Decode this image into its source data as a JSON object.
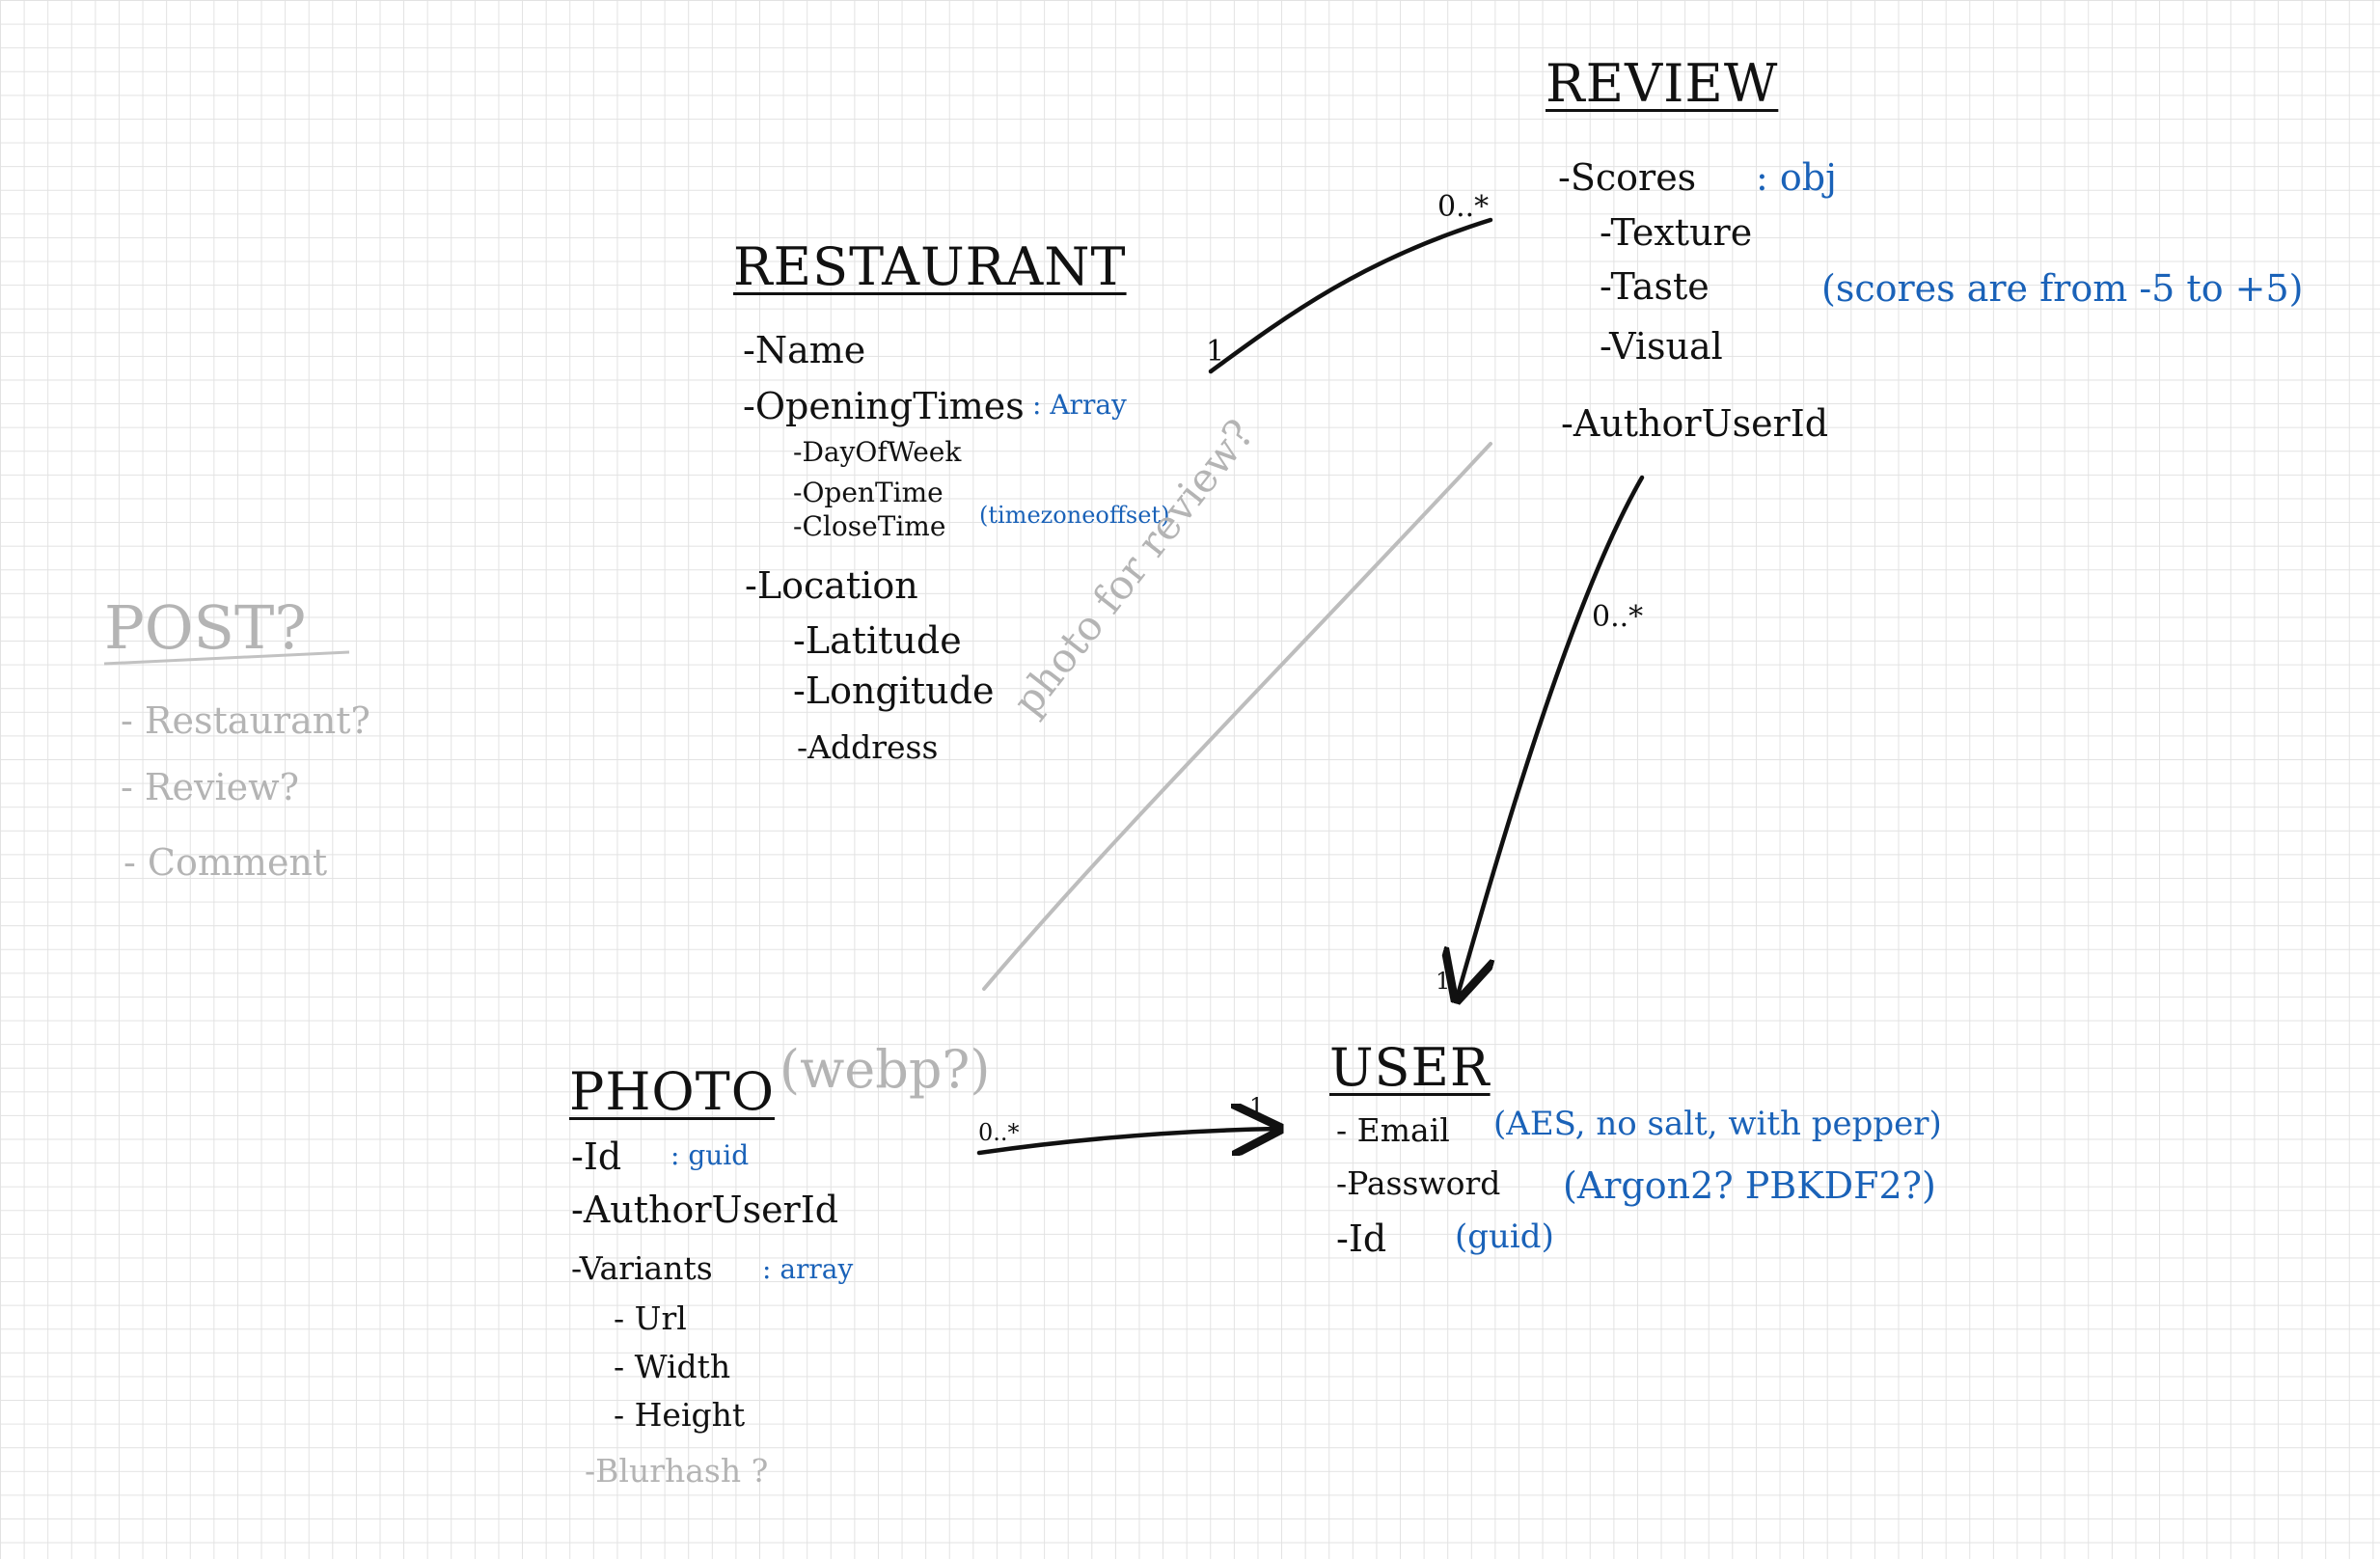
{
  "diagram": {
    "review": {
      "title": "REVIEW",
      "scores": "-Scores",
      "scores_type": ": obj",
      "texture": "-Texture",
      "taste": "-Taste",
      "visual": "-Visual",
      "scores_note": "(scores are from -5 to +5)",
      "author_user_id": "-AuthorUserId"
    },
    "restaurant": {
      "title": "RESTAURANT",
      "name": "-Name",
      "opening_times": "-OpeningTimes",
      "opening_times_type": ": Array",
      "day_of_week": "-DayOfWeek",
      "open_time": "-OpenTime",
      "close_time": "-CloseTime",
      "time_note": "(timezoneoffset)",
      "location": "-Location",
      "latitude": "-Latitude",
      "longitude": "-Longitude",
      "address": "-Address"
    },
    "post": {
      "title": "POST?",
      "items": [
        "- Restaurant?",
        "- Review?",
        "- Comment"
      ]
    },
    "photo": {
      "title": "PHOTO",
      "title_note": "(webp?)",
      "id": "-Id",
      "id_type": ": guid",
      "author_user_id": "-AuthorUserId",
      "variants": "-Variants",
      "variants_type": ": array",
      "url": "- Url",
      "width": "- Width",
      "height": "- Height",
      "blurhash": "-Blurhash ?"
    },
    "user": {
      "title": "USER",
      "email": "- Email",
      "email_note": "(AES, no salt, with pepper)",
      "password": "-Password",
      "password_note": "(Argon2? PBKDF2?)",
      "id": "-Id",
      "id_note": "(guid)"
    },
    "relations": {
      "restaurant_review_one": "1",
      "restaurant_review_many": "0..*",
      "review_user_many": "0..*",
      "review_user_one": "1",
      "photo_user_many": "0..*",
      "photo_user_one": "1",
      "photo_review_label": "photo for review?"
    },
    "colors": {
      "ink": "#111111",
      "annotation_blue": "#1a62b8",
      "draft_grey": "#b4b4b4",
      "grid": "#e2e2e2"
    }
  }
}
